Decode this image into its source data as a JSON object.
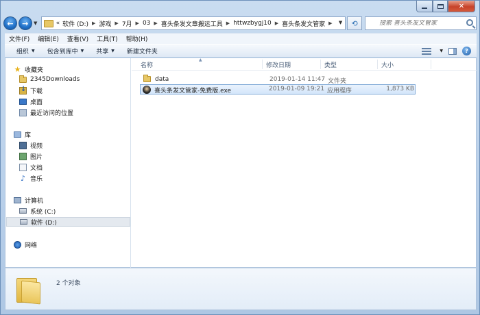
{
  "window": {
    "controls": {
      "minimize": "",
      "maximize": "",
      "close": "✕"
    }
  },
  "address_bar": {
    "prefix": "«",
    "crumbs": [
      "软件 (D:)",
      "游戏",
      "7月",
      "03",
      "喜头条发文章搬运工具",
      "httwzbygj10",
      "喜头条发文管家"
    ],
    "search_placeholder": "搜索 喜头条发文管家"
  },
  "menu": [
    "文件(F)",
    "编辑(E)",
    "查看(V)",
    "工具(T)",
    "帮助(H)"
  ],
  "toolbar": {
    "organize": "组织",
    "include_in_library": "包含到库中",
    "share": "共享",
    "new_folder": "新建文件夹"
  },
  "nav": {
    "favorites": {
      "label": "收藏夹",
      "items": [
        "2345Downloads",
        "下载",
        "桌面",
        "最近访问的位置"
      ]
    },
    "libraries": {
      "label": "库",
      "items": [
        "视频",
        "图片",
        "文档",
        "音乐"
      ]
    },
    "computer": {
      "label": "计算机",
      "items": [
        "系统 (C:)",
        "软件 (D:)"
      ],
      "selected": "软件 (D:)"
    },
    "network": {
      "label": "网络"
    }
  },
  "columns": {
    "name": "名称",
    "modified": "修改日期",
    "type": "类型",
    "size": "大小"
  },
  "files": [
    {
      "name": "data",
      "modified": "2019-01-14 11:47",
      "type": "文件夹",
      "size": "",
      "icon": "folder-icon",
      "selected": false
    },
    {
      "name": "喜头条发文管家-免费版.exe",
      "modified": "2019-01-09 19:21",
      "type": "应用程序",
      "size": "1,873 KB",
      "icon": "app-exe-icon",
      "selected": true
    }
  ],
  "details": {
    "count": "2 个对象"
  },
  "colors": {
    "accent": "#1f6fc7",
    "selection_border": "#84acd8",
    "selection_fill": "#d3e6fa",
    "folder": "#e7c766"
  }
}
